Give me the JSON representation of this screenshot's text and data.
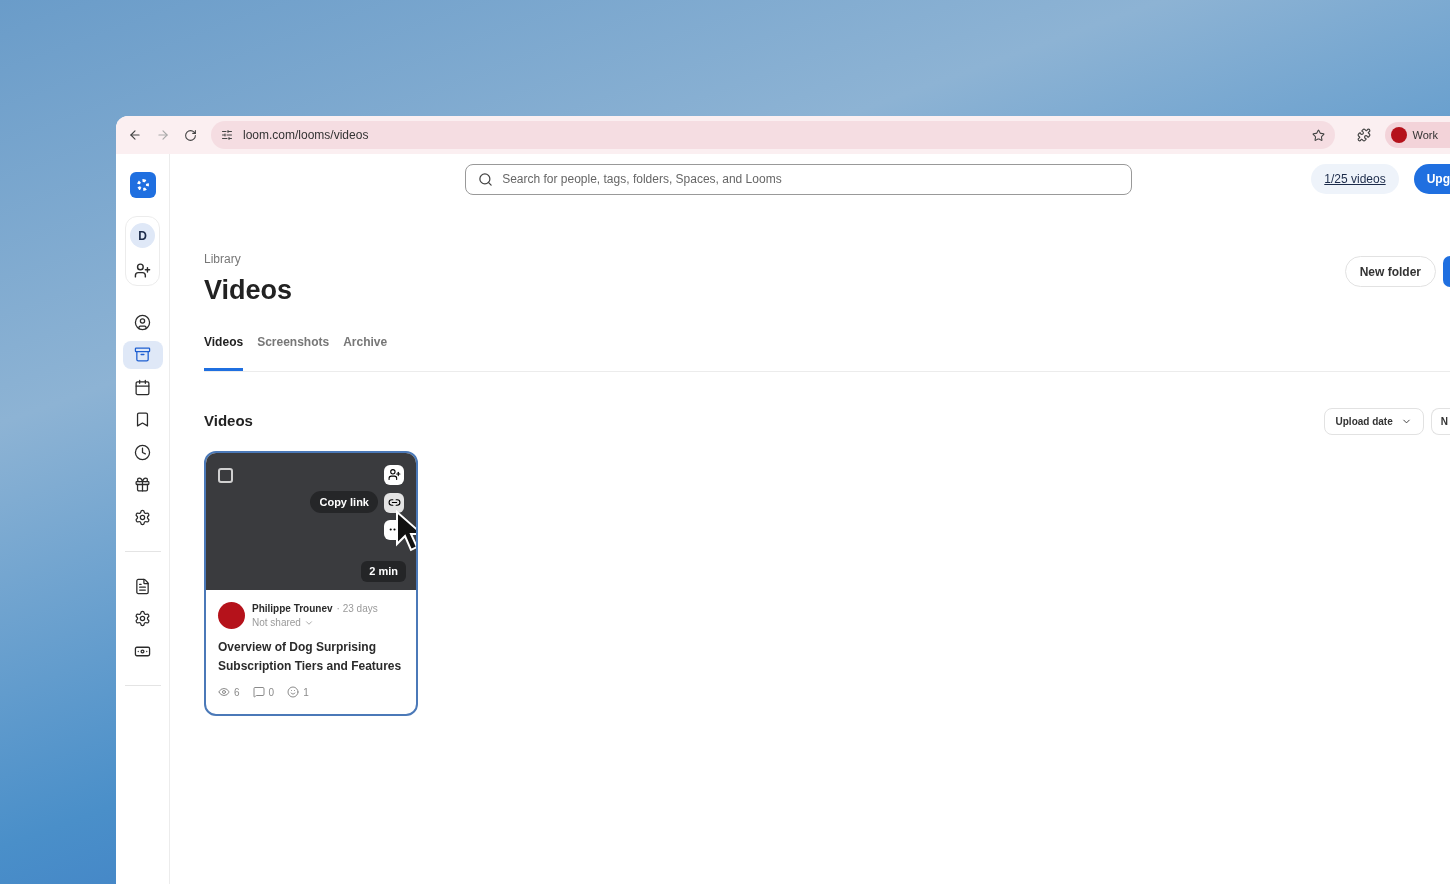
{
  "browser": {
    "url": "loom.com/looms/videos",
    "profile_label": "Work"
  },
  "sidebar": {
    "workspace_initial": "D",
    "nav": [
      {
        "selected": false
      },
      {
        "selected": true
      },
      {
        "selected": false
      },
      {
        "selected": false
      },
      {
        "selected": false
      },
      {
        "selected": false
      },
      {
        "selected": false
      }
    ],
    "bottom_nav": [
      {
        "selected": false
      },
      {
        "selected": false
      },
      {
        "selected": false
      }
    ]
  },
  "topbar": {
    "search": {
      "placeholder": "Search for people, tags, folders, Spaces, and Looms"
    },
    "usage": "1/25 videos",
    "upgrade": "Upg"
  },
  "header": {
    "breadcrumb": "Library",
    "title": "Videos",
    "new_folder": "New folder"
  },
  "tabs": [
    {
      "label": "Videos",
      "selected": true
    },
    {
      "label": "Screenshots",
      "selected": false
    },
    {
      "label": "Archive",
      "selected": false
    }
  ],
  "section": {
    "title": "Videos",
    "sort": "Upload date",
    "filter": "N"
  },
  "videos": [
    {
      "checked": false,
      "tooltip": "Copy link",
      "duration": "2 min",
      "author": "Philippe Trounev",
      "separator": "·",
      "age": "23 days",
      "sharing": "Not shared",
      "title": "Overview of Dog Surprising Subscription Tiers and Features",
      "views": "6",
      "comments": "0",
      "reactions": "1"
    }
  ]
}
